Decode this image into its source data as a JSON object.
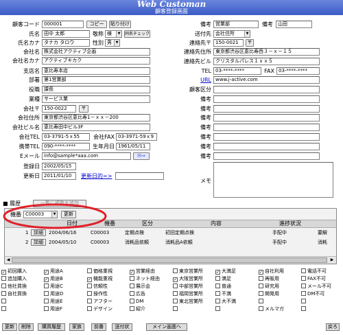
{
  "app": {
    "title": "Web Customan",
    "subtitle": "顧客登録画面"
  },
  "left": {
    "code": {
      "label": "顧客コード",
      "value": "000001",
      "copy": "コピー",
      "paste": "貼り付け"
    },
    "name": {
      "label": "氏名",
      "value": "田中 太郎",
      "honorific_label": "敬称",
      "honorific": "様",
      "check": "同名チェック"
    },
    "kana": {
      "label": "氏名カナ",
      "value": "タナカ タロウ",
      "gender_label": "性別",
      "gender": "男"
    },
    "company": {
      "label": "会社名",
      "value": "株式会社アクティブ企画"
    },
    "company_kana": {
      "label": "会社名カナ",
      "value": "アクティブキカク"
    },
    "branch": {
      "label": "支店名",
      "value": "恵比寿本店"
    },
    "dept": {
      "label": "部署",
      "value": "第1営業部"
    },
    "position": {
      "label": "役職",
      "value": "課長"
    },
    "industry": {
      "label": "業種",
      "value": "サービス業"
    },
    "zip": {
      "label": "会社〒",
      "value": "150-0022",
      "btn": "〒"
    },
    "address": {
      "label": "会社住所",
      "value": "東京都渋谷区恵比寿1－ｘｘ－200"
    },
    "building": {
      "label": "会社ビル名",
      "value": "恵比寿田中ビル3F"
    },
    "tel": {
      "label": "会社TEL",
      "value": "03-3791-5ｘ55",
      "fax_label": "会社FAX",
      "fax": "03-3971-59ｘ9"
    },
    "mobile": {
      "label": "携帯TEL",
      "value": "090-****-****",
      "birth_label": "生年月日",
      "birth": "1961/05/11"
    },
    "email": {
      "label": "Eメール",
      "value": "info@sample*aaa.com"
    },
    "registered": {
      "label": "登録日",
      "value": "2002/05/15"
    },
    "updated": {
      "label": "更新日",
      "value": "2011/01/10",
      "next_link": "更新日的=>"
    }
  },
  "right": {
    "note1": {
      "label": "備考",
      "value": "営業部",
      "label2": "備考",
      "value2": "山田"
    },
    "shipto": {
      "label": "送付先",
      "value": "会社住所"
    },
    "shipzip": {
      "label": "連絡先〒",
      "value": "150-0021",
      "btn": "〒"
    },
    "shipaddr": {
      "label": "連絡先住所",
      "value": "東京都渋谷区恵比寿西３－ｘ－１５"
    },
    "shipbldg": {
      "label": "連絡先ビル",
      "value": "クリスタルパレス１ｘｘ５"
    },
    "tel": {
      "label": "TEL",
      "value": "03-****-****",
      "fax_label": "FAX",
      "fax": "03-****-****"
    },
    "url": {
      "label": "URL",
      "value": "www.j-active.com"
    },
    "category": {
      "label": "顧客区分"
    },
    "notes": [
      "備考",
      "備考",
      "備考",
      "備考",
      "備考",
      "備考",
      "備考"
    ],
    "memo": {
      "label": "メモ"
    }
  },
  "history": {
    "section_label": "■ 履歴",
    "hidden_button": "一覧に複数を追加",
    "model_label": "機番",
    "model_value": "C00003",
    "refresh": "更新",
    "columns": [
      "日付",
      "機番",
      "区分",
      "内容",
      "進捗状況"
    ],
    "rows": [
      {
        "no": "1",
        "detail": "詳細",
        "date": "2004/06/16",
        "model": "C00003",
        "type": "定期点検",
        "content": "初回定期点検",
        "status": "手配中",
        "extra": "要解"
      },
      {
        "no": "2",
        "detail": "詳細",
        "date": "2004/05/10",
        "model": "C00003",
        "type": "消耗品依頼",
        "content": "消耗品A依頼",
        "status": "手配中",
        "extra": "消耗"
      }
    ]
  },
  "checks": [
    [
      {
        "label": "初回購入",
        "checked": true
      },
      {
        "label": "用途A",
        "checked": true
      },
      {
        "label": "価格重視",
        "checked": false
      },
      {
        "label": "営業経由",
        "checked": true
      },
      {
        "label": "東京営業所",
        "checked": false
      },
      {
        "label": "大満足",
        "checked": true
      },
      {
        "label": "自社利用",
        "checked": true
      },
      {
        "label": "電話不可",
        "checked": false
      }
    ],
    [
      {
        "label": "追加購入",
        "checked": false
      },
      {
        "label": "用途B",
        "checked": true
      },
      {
        "label": "機能重視",
        "checked": true
      },
      {
        "label": "ネット経由",
        "checked": false
      },
      {
        "label": "大阪営業所",
        "checked": true
      },
      {
        "label": "満足",
        "checked": false
      },
      {
        "label": "再販用",
        "checked": false
      },
      {
        "label": "FAX不可",
        "checked": false
      }
    ],
    [
      {
        "label": "他社買換",
        "checked": false
      },
      {
        "label": "用途C",
        "checked": false
      },
      {
        "label": "信頼性",
        "checked": false
      },
      {
        "label": "展示会",
        "checked": false
      },
      {
        "label": "中部営業所",
        "checked": false
      },
      {
        "label": "普通",
        "checked": false
      },
      {
        "label": "研究用",
        "checked": false
      },
      {
        "label": "メール不可",
        "checked": false
      }
    ],
    [
      {
        "label": "自社買換",
        "checked": false
      },
      {
        "label": "用途D",
        "checked": false
      },
      {
        "label": "操作性",
        "checked": false
      },
      {
        "label": "広告",
        "checked": false
      },
      {
        "label": "福岡営業所",
        "checked": false
      },
      {
        "label": "不満",
        "checked": false
      },
      {
        "label": "開発用",
        "checked": false
      },
      {
        "label": "DM不可",
        "checked": false
      }
    ],
    [
      {
        "label": "",
        "checked": false
      },
      {
        "label": "用途E",
        "checked": false
      },
      {
        "label": "アフター",
        "checked": false
      },
      {
        "label": "DM",
        "checked": false
      },
      {
        "label": "東北営業所",
        "checked": false
      },
      {
        "label": "大不満",
        "checked": false
      },
      {
        "label": "",
        "checked": false
      },
      {
        "label": "",
        "checked": false
      }
    ],
    [
      {
        "label": "",
        "checked": false
      },
      {
        "label": "用途F",
        "checked": false
      },
      {
        "label": "デザイン",
        "checked": false
      },
      {
        "label": "紹介",
        "checked": false
      },
      {
        "label": "",
        "checked": false
      },
      {
        "label": "",
        "checked": false
      },
      {
        "label": "メルマガ",
        "checked": false
      },
      {
        "label": "",
        "checked": false
      }
    ]
  ],
  "toolbar": {
    "update": "更新",
    "delete": "削除",
    "history": "購買履歴",
    "family": "家族",
    "prev": "前番",
    "ship": "送付状",
    "menu": "メイン画面へ",
    "back": "戻ろ"
  },
  "colors": {
    "banner": "#3b5cc4",
    "highlight_circle": "#e0202a"
  }
}
